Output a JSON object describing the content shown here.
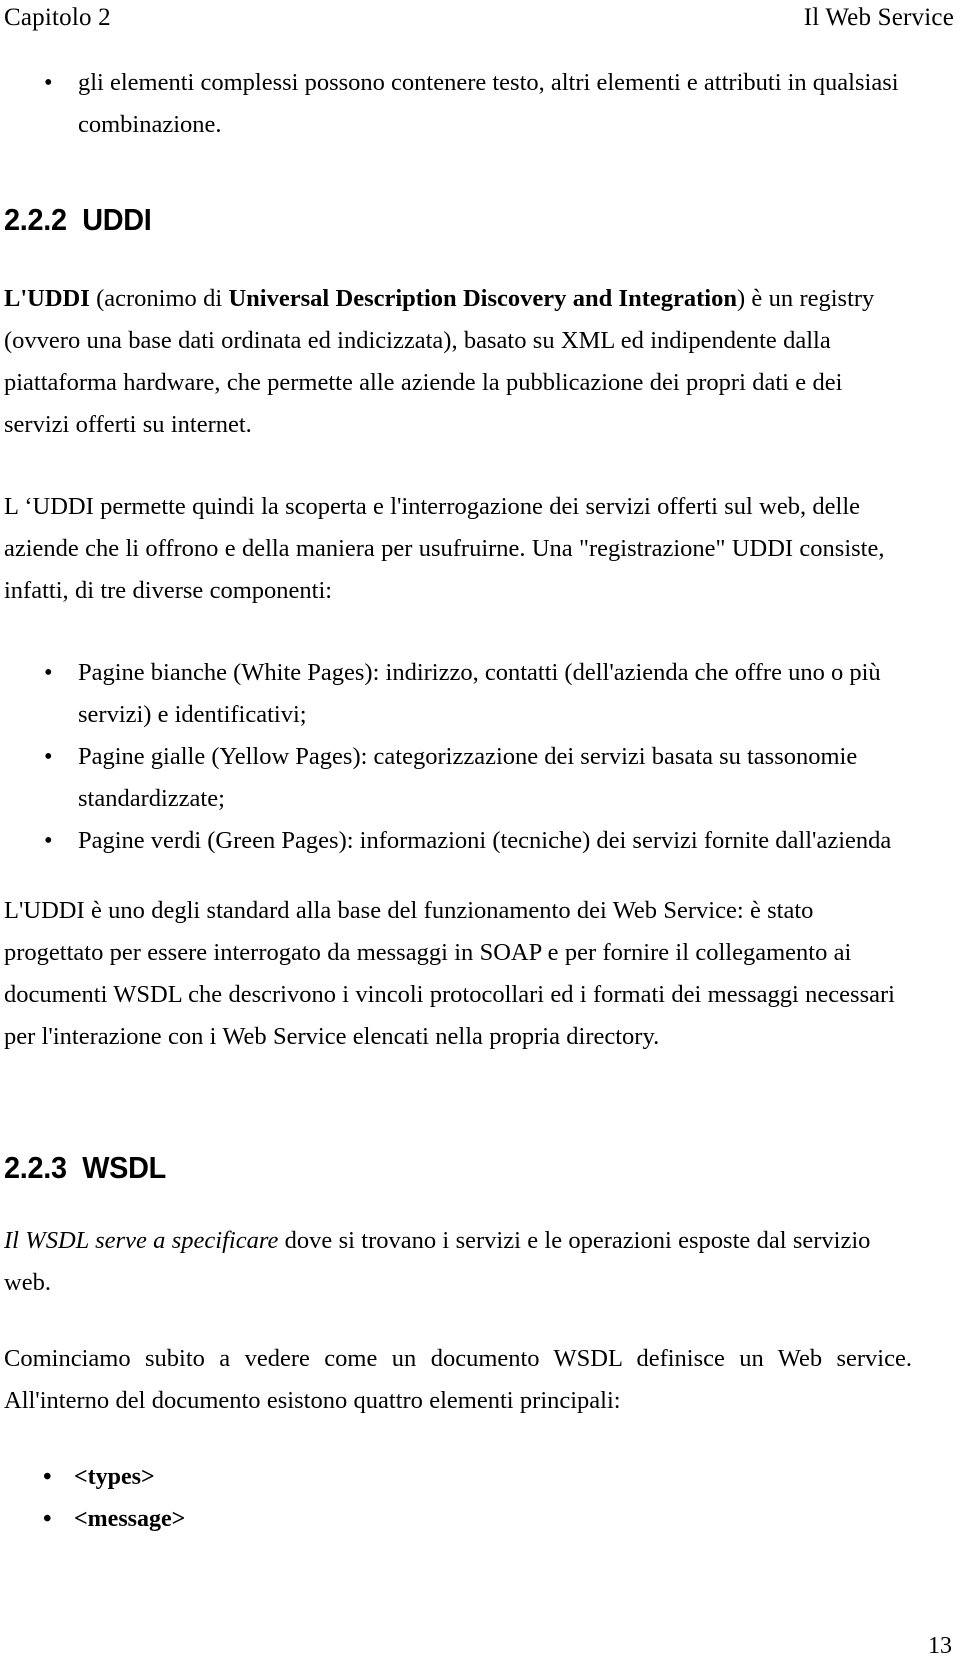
{
  "header": {
    "left": "Capitolo 2",
    "right": "Il Web Service"
  },
  "bullet_glyph": "•",
  "intro_bullets": [
    "gli elementi complessi possono contenere testo, altri elementi e attributi in qualsiasi combinazione."
  ],
  "section_uddi": {
    "number": "2.2.2",
    "title": "UDDI",
    "heading_full": "2.2.2  UDDI",
    "paragraph_1": {
      "lead_bold": "L'UDDI",
      "after_lead": " (acronimo di ",
      "emphasis_bold": "Universal Description Discovery and Integration",
      "tail": ") è un registry (ovvero una base dati ordinata ed indicizzata), basato su XML ed indipendente dalla piattaforma hardware, che permette alle aziende la pubblicazione dei propri dati e dei servizi offerti su internet."
    },
    "paragraph_2": "L ‘UDDI permette quindi la scoperta e l'interrogazione dei servizi offerti sul web, delle aziende che li offrono e della maniera per usufruirne. Una \"registrazione\" UDDI consiste, infatti, di tre diverse componenti:",
    "components": [
      "Pagine bianche (White Pages): indirizzo, contatti (dell'azienda che offre uno o più servizi) e identificativi;",
      "Pagine gialle (Yellow Pages): categorizzazione dei servizi basata su tassonomie standardizzate;",
      "Pagine verdi (Green Pages): informazioni (tecniche) dei servizi fornite dall'azienda"
    ],
    "paragraph_3": "L'UDDI è uno degli standard alla base del funzionamento dei Web Service: è stato progettato per essere interrogato da messaggi in SOAP e per fornire il collegamento ai documenti WSDL che descrivono i vincoli protocollari ed i formati dei messaggi necessari per l'interazione con i Web Service elencati nella propria directory."
  },
  "section_wsdl": {
    "number": "2.2.3",
    "title": "WSDL",
    "heading_full": "2.2.3  WSDL",
    "paragraph_1": {
      "italic_lead": "Il WSDL serve a specificare",
      "tail": " dove si trovano i servizi e le operazioni esposte dal servizio web."
    },
    "paragraph_2": "Cominciamo subito a vedere come un documento WSDL definisce un Web service. All'interno del documento esistono quattro elementi principali:",
    "elements": [
      "<types>",
      "<message>"
    ]
  },
  "page_number": "13"
}
